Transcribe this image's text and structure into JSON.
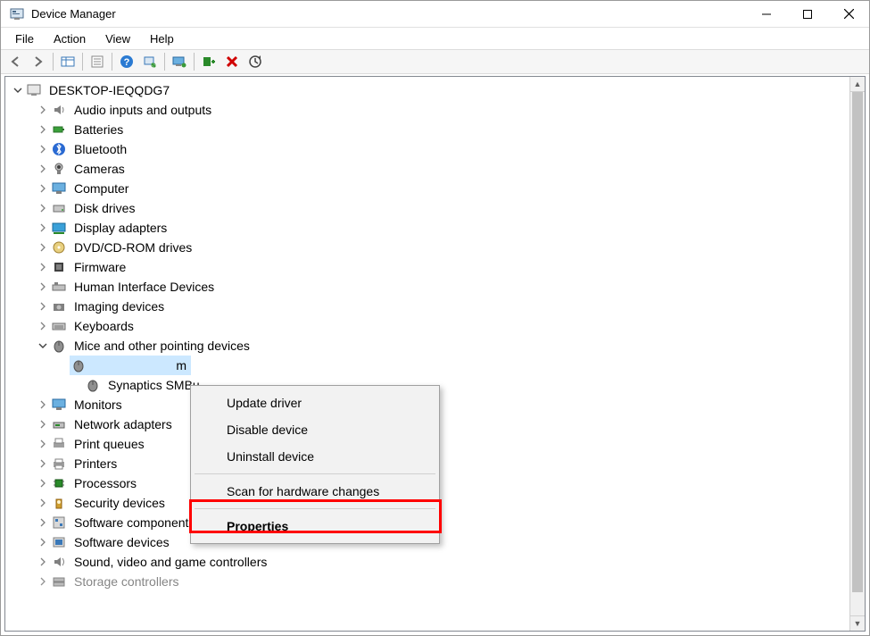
{
  "window": {
    "title": "Device Manager"
  },
  "menubar": {
    "file": "File",
    "action": "Action",
    "view": "View",
    "help": "Help"
  },
  "toolbar_icons": {
    "back": "back-arrow-icon",
    "forward": "forward-arrow-icon",
    "show_hidden": "show-hidden-icon",
    "properties": "properties-icon",
    "help": "help-icon",
    "scan": "scan-hardware-icon",
    "monitor": "monitor-icon",
    "add_legacy": "add-legacy-icon",
    "uninstall": "uninstall-icon",
    "update": "update-driver-icon"
  },
  "tree": {
    "root": {
      "label": "DESKTOP-IEQQDG7",
      "expanded": true
    },
    "nodes": [
      {
        "label": "Audio inputs and outputs",
        "icon": "audio-icon"
      },
      {
        "label": "Batteries",
        "icon": "battery-icon"
      },
      {
        "label": "Bluetooth",
        "icon": "bluetooth-icon"
      },
      {
        "label": "Cameras",
        "icon": "camera-icon"
      },
      {
        "label": "Computer",
        "icon": "computer-icon"
      },
      {
        "label": "Disk drives",
        "icon": "disk-icon"
      },
      {
        "label": "Display adapters",
        "icon": "display-icon"
      },
      {
        "label": "DVD/CD-ROM drives",
        "icon": "dvd-icon"
      },
      {
        "label": "Firmware",
        "icon": "firmware-icon"
      },
      {
        "label": "Human Interface Devices",
        "icon": "hid-icon"
      },
      {
        "label": "Imaging devices",
        "icon": "imaging-icon"
      },
      {
        "label": "Keyboards",
        "icon": "keyboard-icon"
      },
      {
        "label": "Mice and other pointing devices",
        "icon": "mouse-icon",
        "expanded": true,
        "children": [
          {
            "label": "",
            "icon": "mouse-icon",
            "selected": true,
            "truncated_suffix": "m"
          },
          {
            "label": "Synaptics SMBu",
            "icon": "mouse-icon",
            "truncated": true
          }
        ]
      },
      {
        "label": "Monitors",
        "icon": "monitor-icon"
      },
      {
        "label": "Network adapters",
        "icon": "network-icon"
      },
      {
        "label": "Print queues",
        "icon": "printqueue-icon"
      },
      {
        "label": "Printers",
        "icon": "printer-icon"
      },
      {
        "label": "Processors",
        "icon": "cpu-icon"
      },
      {
        "label": "Security devices",
        "icon": "security-icon"
      },
      {
        "label": "Software components",
        "icon": "swcomp-icon"
      },
      {
        "label": "Software devices",
        "icon": "swdev-icon"
      },
      {
        "label": "Sound, video and game controllers",
        "icon": "sound-icon"
      },
      {
        "label": "Storage controllers",
        "icon": "storage-icon",
        "cutoff": true
      }
    ]
  },
  "context_menu": {
    "update": "Update driver",
    "disable": "Disable device",
    "uninstall": "Uninstall device",
    "scan": "Scan for hardware changes",
    "properties": "Properties"
  }
}
